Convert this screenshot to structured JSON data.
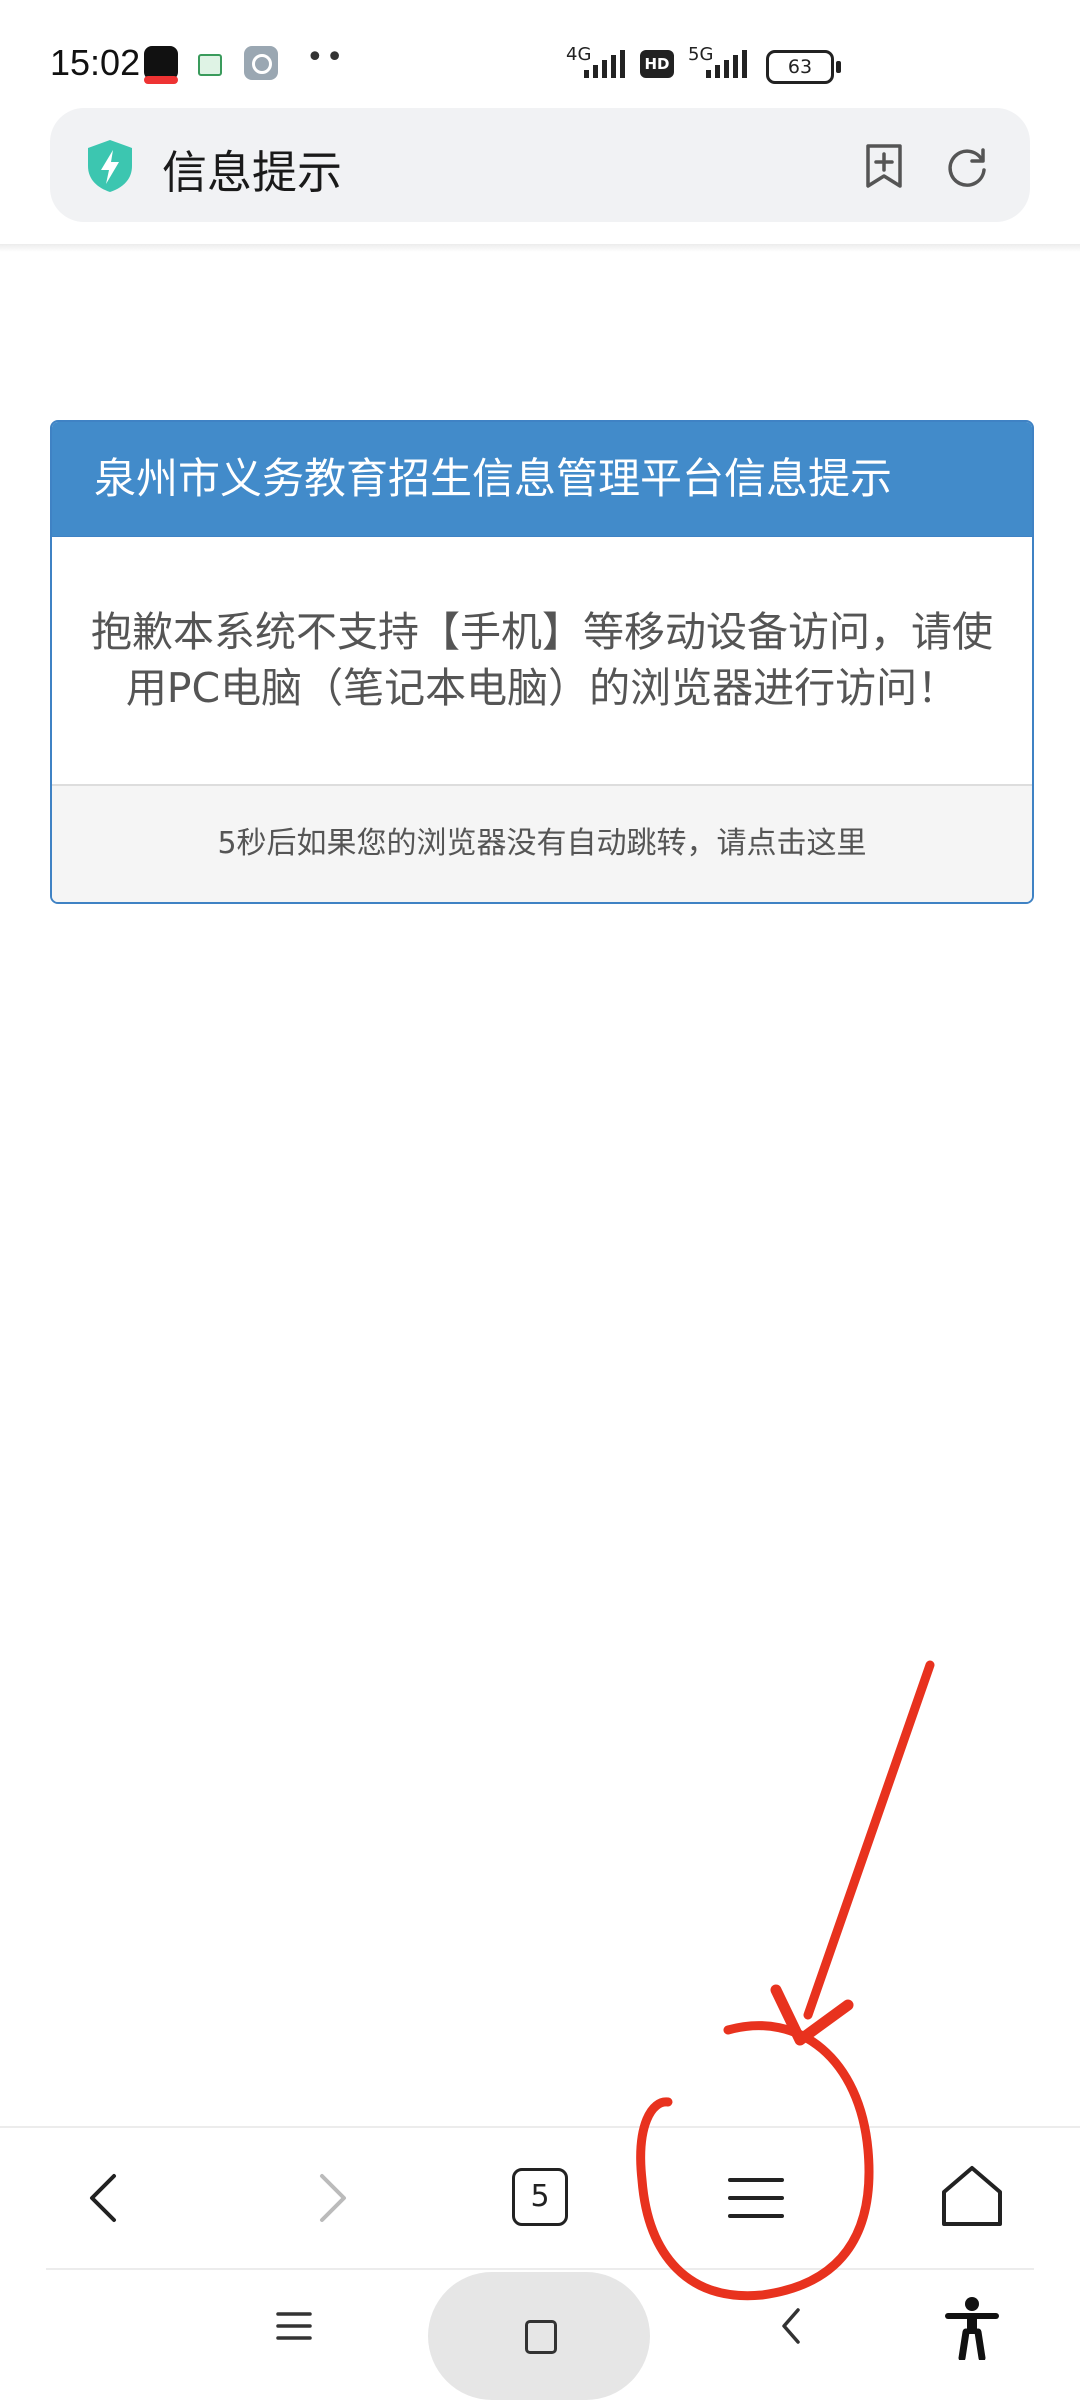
{
  "status_bar": {
    "time": "15:02",
    "network_1": "4G",
    "network_2": "5G",
    "hd_badge": "HD",
    "battery": "63"
  },
  "address_bar": {
    "title": "信息提示",
    "icons": [
      "shield-bolt-icon",
      "bookmark-add-icon",
      "refresh-icon"
    ]
  },
  "notice": {
    "heading": "泉州市义务教育招生信息管理平台信息提示",
    "message": "抱歉本系统不支持【手机】等移动设备访问，请使用PC电脑（笔记本电脑）的浏览器进行访问！",
    "footer": "5秒后如果您的浏览器没有自动跳转，请点击这里"
  },
  "browser_nav": {
    "tab_count": "5",
    "icons": [
      "back-icon",
      "forward-icon",
      "tabs-icon",
      "menu-icon",
      "home-icon"
    ]
  },
  "system_nav": {
    "icons": [
      "recents-icon",
      "home-button-icon",
      "back-icon",
      "accessibility-icon"
    ]
  },
  "colors": {
    "panel_heading": "#428bca",
    "panel_border": "#3f82c4",
    "shield": "#3cc6b0",
    "annotation": "#e8321e"
  }
}
